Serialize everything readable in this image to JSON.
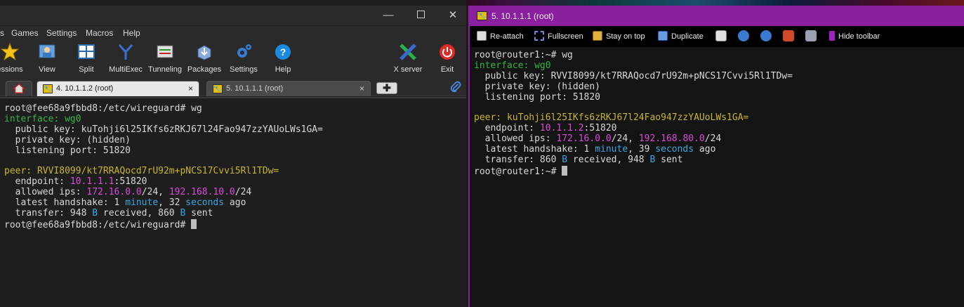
{
  "left_window": {
    "menu": [
      "s",
      "Games",
      "Settings",
      "Macros",
      "Help"
    ],
    "toolbar": {
      "sessions": "essions",
      "view": "View",
      "split": "Split",
      "multiexec": "MultiExec",
      "tunneling": "Tunneling",
      "packages": "Packages",
      "settings": "Settings",
      "help": "Help",
      "xserver": "X server",
      "exit": "Exit"
    },
    "tabs": [
      {
        "title": "4. 10.1.1.2 (root)",
        "close": "×"
      },
      {
        "title": "5. 10.1.1.1 (root)",
        "close": "×"
      }
    ],
    "new_tab": "✚",
    "terminal": {
      "prompt_cmd": "root@fee68a9fbbd8:/etc/wireguard# wg",
      "interface_label": "interface:",
      "interface_name": "wg0",
      "public_key": "  public key: kuTohji6l25IKfs6zRKJ67l24Fao947zzYAUoLWs1GA=",
      "private_key": "  private key: (hidden)",
      "listening_port": "  listening port: 51820",
      "peer_label": "peer:",
      "peer_key": "RVVI8099/kt7RRAQocd7rU92m+pNCS17Cvvi5Rl1TDw=",
      "endpoint_label": "  endpoint: ",
      "endpoint_ip": "10.1.1.1",
      "endpoint_port": ":51820",
      "allowed_label": "  allowed ips: ",
      "allowed_ip1": "172.16.0.0",
      "allowed_mask1": "/24, ",
      "allowed_ip2": "192.168.10.0",
      "allowed_mask2": "/24",
      "handshake_label": "  latest handshake: 1 ",
      "handshake_unit1": "minute",
      "handshake_mid": ", 32 ",
      "handshake_unit2": "seconds",
      "handshake_end": " ago",
      "transfer_label": "  transfer: 948 ",
      "transfer_b1": "B",
      "transfer_mid": " received, 860 ",
      "transfer_b2": "B",
      "transfer_end": " sent",
      "final_prompt": "root@fee68a9fbbd8:/etc/wireguard# "
    }
  },
  "right_window": {
    "title": "5. 10.1.1.1 (root)",
    "toolbar": {
      "reattach": "Re-attach",
      "fullscreen": "Fullscreen",
      "stay_on_top": "Stay on top",
      "duplicate": "Duplicate",
      "hide_toolbar": "Hide toolbar"
    },
    "terminal": {
      "prompt_cmd": "root@router1:~# wg",
      "interface_label": "interface:",
      "interface_name": "wg0",
      "public_key": "  public key: RVVI8099/kt7RRAQocd7rU92m+pNCS17Cvvi5Rl1TDw=",
      "private_key": "  private key: (hidden)",
      "listening_port": "  listening port: 51820",
      "peer_label": "peer:",
      "peer_key": "kuTohji6l25IKfs6zRKJ67l24Fao947zzYAUoLWs1GA=",
      "endpoint_label": "  endpoint: ",
      "endpoint_ip": "10.1.1.2",
      "endpoint_port": ":51820",
      "allowed_label": "  allowed ips: ",
      "allowed_ip1": "172.16.0.0",
      "allowed_mask1": "/24, ",
      "allowed_ip2": "192.168.80.0",
      "allowed_mask2": "/24",
      "handshake_label": "  latest handshake: 1 ",
      "handshake_unit1": "minute",
      "handshake_mid": ", 39 ",
      "handshake_unit2": "seconds",
      "handshake_end": " ago",
      "transfer_label": "  transfer: 860 ",
      "transfer_b1": "B",
      "transfer_mid": " received, 948 ",
      "transfer_b2": "B",
      "transfer_end": " sent",
      "final_prompt": "root@router1:~# "
    }
  },
  "colors": {
    "accent_purple": "#8a1fa0",
    "term_green": "#38b24a",
    "term_yellow": "#c9b52a",
    "term_magenta": "#d94bd9",
    "term_cyan": "#3aa6de"
  }
}
